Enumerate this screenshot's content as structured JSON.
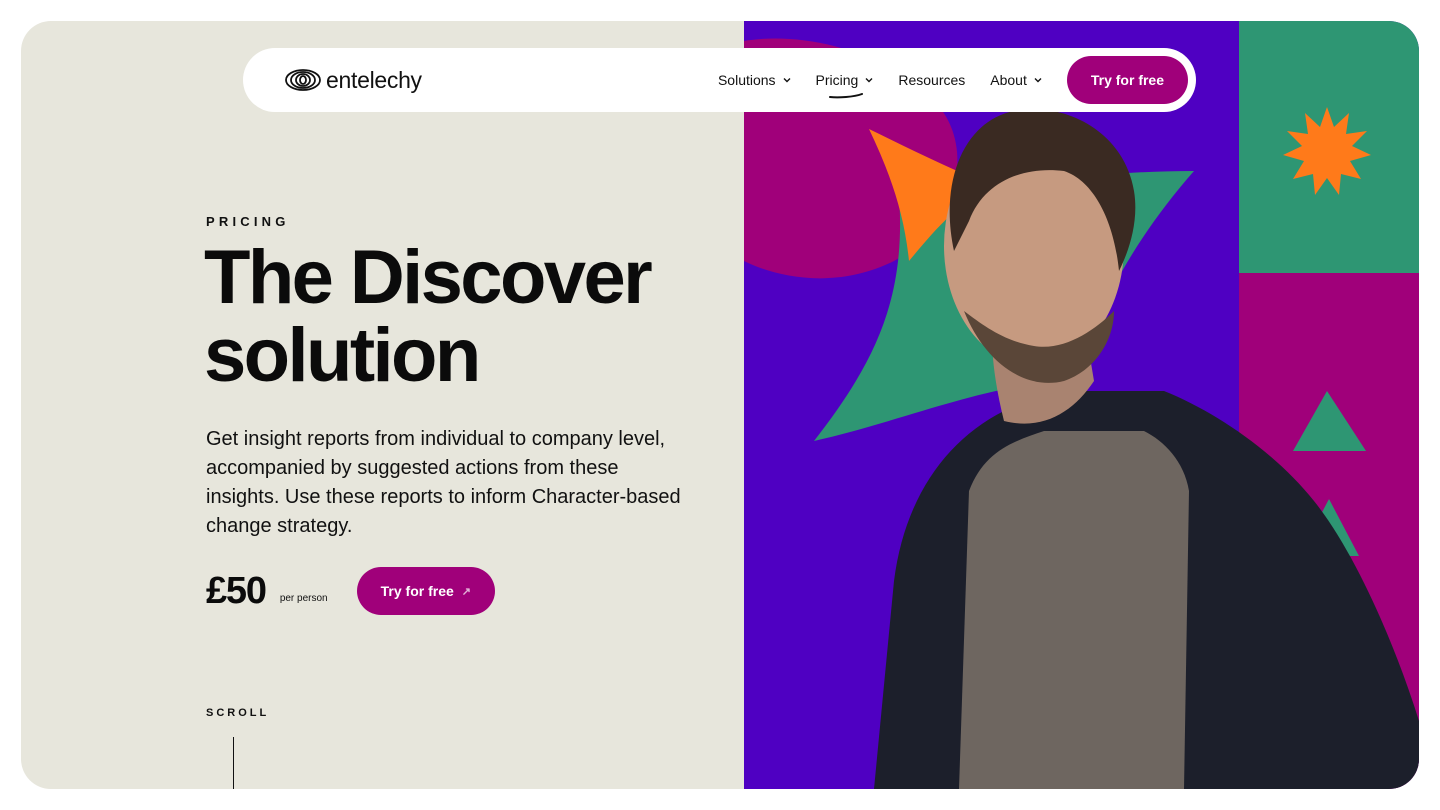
{
  "brand": {
    "name": "entelechy",
    "logo_icon": "spring-coil-logo"
  },
  "nav": {
    "items": [
      {
        "label": "Solutions",
        "has_dropdown": true
      },
      {
        "label": "Pricing",
        "has_dropdown": true,
        "active": true
      },
      {
        "label": "Resources",
        "has_dropdown": false
      },
      {
        "label": "About",
        "has_dropdown": true
      }
    ],
    "cta_label": "Try for free"
  },
  "hero": {
    "eyebrow": "PRICING",
    "title_line1": "The Discover",
    "title_line2": "solution",
    "description": "Get insight reports from individual to company level, accompanied by suggested actions from these insights. Use these reports to inform Character-based change strategy.",
    "price": "£50",
    "price_unit": "per person",
    "cta_label": "Try for free",
    "cta_icon": "arrow-up-right-icon",
    "scroll_label": "SCROLL"
  },
  "colors": {
    "background": "#e7e6dc",
    "accent": "#a0007a",
    "purple": "#4f00c2",
    "green": "#2e9673",
    "orange": "#ff7a1a",
    "magenta": "#a0007a"
  }
}
